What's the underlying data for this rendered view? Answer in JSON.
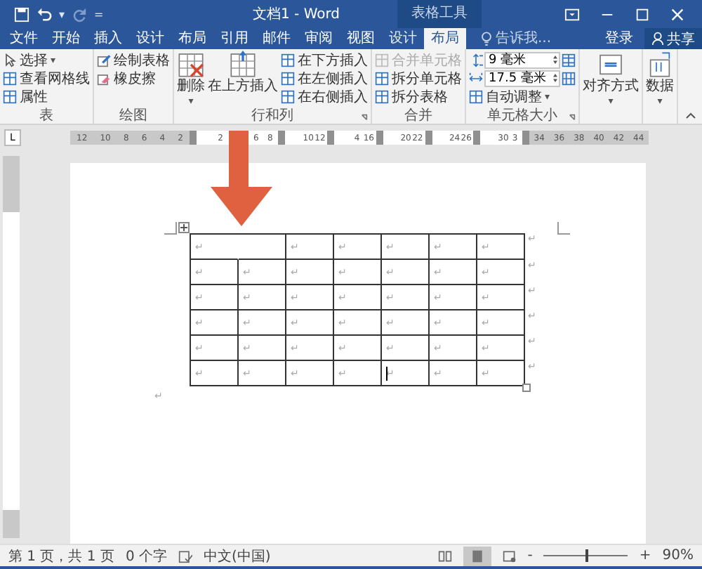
{
  "window": {
    "title": "文档1 - Word",
    "context_title": "表格工具"
  },
  "quick_access": {
    "undo_caret": "▾",
    "customize": "="
  },
  "tabs": [
    {
      "label": "文件",
      "selected": false,
      "context": false
    },
    {
      "label": "开始",
      "selected": false,
      "context": false
    },
    {
      "label": "插入",
      "selected": false,
      "context": false
    },
    {
      "label": "设计",
      "selected": false,
      "context": false
    },
    {
      "label": "布局",
      "selected": false,
      "context": false
    },
    {
      "label": "引用",
      "selected": false,
      "context": false
    },
    {
      "label": "邮件",
      "selected": false,
      "context": false
    },
    {
      "label": "审阅",
      "selected": false,
      "context": false
    },
    {
      "label": "视图",
      "selected": false,
      "context": false
    },
    {
      "label": "设计",
      "selected": false,
      "context": true
    },
    {
      "label": "布局",
      "selected": true,
      "context": true
    }
  ],
  "tell_me": {
    "placeholder": "告诉我..."
  },
  "sign_in": "登录",
  "share": "共享",
  "ribbon": [
    {
      "label": "表",
      "items": [
        {
          "kind": "small",
          "label": "选择",
          "caret": "▾"
        },
        {
          "kind": "small",
          "label": "查看网格线"
        },
        {
          "kind": "small",
          "label": "属性"
        }
      ]
    },
    {
      "label": "绘图",
      "items": [
        {
          "kind": "small",
          "label": "绘制表格"
        },
        {
          "kind": "small",
          "label": "橡皮擦"
        }
      ]
    },
    {
      "label": "行和列",
      "launcher": true,
      "items": [
        {
          "kind": "large",
          "label": "删除",
          "caret": "▾"
        },
        {
          "kind": "large",
          "label": "在上方插入"
        },
        {
          "kind": "small",
          "label": "在下方插入"
        },
        {
          "kind": "small",
          "label": "在左侧插入"
        },
        {
          "kind": "small",
          "label": "在右侧插入"
        }
      ]
    },
    {
      "label": "合并",
      "items": [
        {
          "kind": "small",
          "label": "合并单元格",
          "disabled": true
        },
        {
          "kind": "small",
          "label": "拆分单元格",
          "disabled": false
        },
        {
          "kind": "small",
          "label": "拆分表格",
          "disabled": false
        }
      ]
    },
    {
      "label": "单元格大小",
      "launcher": true,
      "items": [
        {
          "kind": "spinner",
          "value": "9 毫米"
        },
        {
          "kind": "spinner",
          "value": "17.5 毫米"
        },
        {
          "kind": "small",
          "label": "自动调整",
          "caret": "▾"
        }
      ]
    },
    {
      "items": [
        {
          "kind": "large",
          "label": "对齐方式",
          "caret": "▾"
        }
      ]
    },
    {
      "items": [
        {
          "kind": "large",
          "label": "数据",
          "caret": "▾"
        }
      ]
    }
  ],
  "ruler": {
    "tab_selector": "L",
    "segments": [
      {
        "kind": "margin",
        "labels": [
          "12",
          "10",
          "8",
          "6",
          "4",
          "2"
        ]
      },
      {
        "kind": "cell",
        "labels": [
          "2",
          "6",
          "8"
        ]
      },
      {
        "kind": "cell",
        "labels": [
          "10",
          "12"
        ]
      },
      {
        "kind": "cell",
        "labels": [
          "4",
          "16"
        ]
      },
      {
        "kind": "cell",
        "labels": [
          "20",
          "22"
        ]
      },
      {
        "kind": "cell",
        "labels": [
          "24",
          "26"
        ]
      },
      {
        "kind": "cell",
        "labels": [
          "30",
          "3"
        ]
      },
      {
        "kind": "margin",
        "labels": [
          "34",
          "36",
          "38",
          "40",
          "42",
          "44"
        ]
      }
    ]
  },
  "table": {
    "rows": [
      {
        "cells": [
          {
            "text": "↵",
            "merged": false
          },
          {
            "text": "",
            "merged": true
          },
          {
            "text": "↵",
            "merged": false
          },
          {
            "text": "↵",
            "merged": false
          },
          {
            "text": "↵",
            "merged": false
          },
          {
            "text": "↵",
            "merged": false
          },
          {
            "text": "↵",
            "merged": false
          }
        ],
        "end_mark": "↵"
      },
      {
        "cells": [
          {
            "text": "↵"
          },
          {
            "text": "↵"
          },
          {
            "text": "↵"
          },
          {
            "text": "↵"
          },
          {
            "text": "↵"
          },
          {
            "text": "↵"
          },
          {
            "text": "↵"
          }
        ],
        "end_mark": "↵"
      },
      {
        "cells": [
          {
            "text": "↵"
          },
          {
            "text": "↵"
          },
          {
            "text": "↵"
          },
          {
            "text": "↵"
          },
          {
            "text": "↵"
          },
          {
            "text": "↵"
          },
          {
            "text": "↵"
          }
        ],
        "end_mark": "↵"
      },
      {
        "cells": [
          {
            "text": "↵"
          },
          {
            "text": "↵"
          },
          {
            "text": "↵"
          },
          {
            "text": "↵"
          },
          {
            "text": "↵"
          },
          {
            "text": "↵"
          },
          {
            "text": "↵"
          }
        ],
        "end_mark": "↵"
      },
      {
        "cells": [
          {
            "text": "↵"
          },
          {
            "text": "↵"
          },
          {
            "text": "↵"
          },
          {
            "text": "↵"
          },
          {
            "text": "↵"
          },
          {
            "text": "↵"
          },
          {
            "text": "↵"
          }
        ],
        "end_mark": "↵"
      },
      {
        "cells": [
          {
            "text": "↵"
          },
          {
            "text": "↵"
          },
          {
            "text": "↵"
          },
          {
            "text": "↵"
          },
          {
            "text": "↵",
            "caret": true
          },
          {
            "text": "↵"
          },
          {
            "text": "↵"
          }
        ],
        "end_mark": "↵"
      }
    ],
    "after_mark": "↵"
  },
  "status_bar": {
    "page": "第 1 页，共 1 页",
    "words": "0 个字",
    "language": "中文(中国)",
    "zoom_out": "-",
    "zoom_in": "+",
    "zoom": {
      "level": 0.5
    },
    "zoom_reading": "90%"
  }
}
